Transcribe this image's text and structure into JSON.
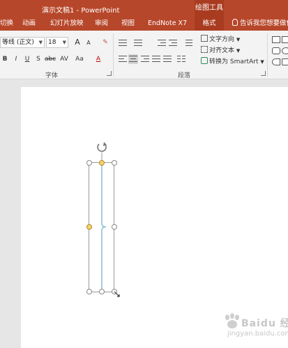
{
  "titlebar": {
    "title": "演示文稿1 - PowerPoint",
    "contextual_label": "绘图工具"
  },
  "tabs": {
    "items": [
      {
        "label": "切换"
      },
      {
        "label": "动画"
      },
      {
        "label": "幻灯片放映"
      },
      {
        "label": "审阅"
      },
      {
        "label": "视图"
      },
      {
        "label": "EndNote X7"
      },
      {
        "label": "格式"
      }
    ],
    "active": "格式",
    "tell_me": "告诉我您想要做什"
  },
  "ribbon": {
    "font": {
      "font_name": "等线 (正文)",
      "font_size": "18",
      "grow_label": "A",
      "shrink_label": "A",
      "bold": "B",
      "italic": "I",
      "underline": "U",
      "shadow": "S",
      "strikethrough": "abc",
      "spacing": "AV",
      "change_case": "Aa",
      "font_color": "A",
      "group_label": "字体"
    },
    "paragraph": {
      "text_direction": "文字方向",
      "align_text": "对齐文本",
      "convert_smartart": "转换为 SmartArt",
      "group_label": "段落"
    }
  },
  "colors": {
    "accent": "#b7472a",
    "accent_dark": "#a93c20",
    "ribbon_bg": "#f3f3f3",
    "canvas_bg": "#e6e6e6",
    "brace_line": "#8fc3d6",
    "handle_yellow": "#f5d36b"
  },
  "icons": {
    "rotate_handle": "rotate-handle-icon",
    "eraser": "eraser-icon",
    "bulb": "lightbulb-icon"
  },
  "watermark": {
    "main": "Baidu 经验",
    "sub": "jingyan.baidu.com"
  }
}
